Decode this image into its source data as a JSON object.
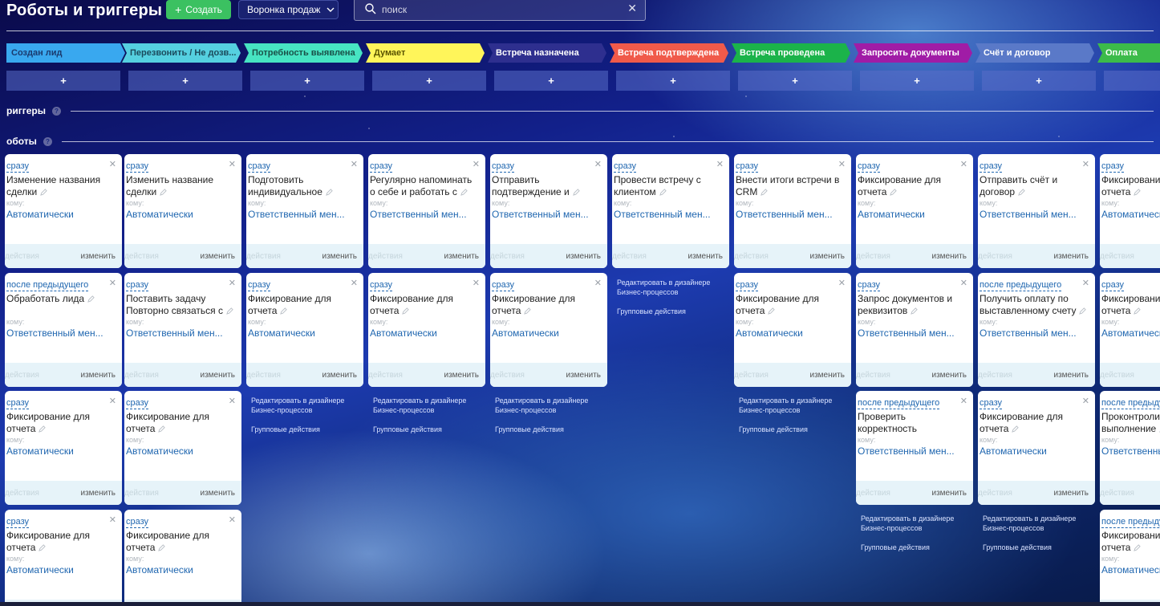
{
  "page": {
    "title": "Роботы и триггеры"
  },
  "header": {
    "create_label": "Создать",
    "pipeline_label": "Воронка продаж",
    "search_placeholder": "поиск"
  },
  "stages": [
    {
      "label": "Создан лид",
      "color": "#39a8ef",
      "text": "#1a3a6e"
    },
    {
      "label": "Перезвонить / Не дозв...",
      "color": "#55d0e0",
      "text": "#1b4a5c"
    },
    {
      "label": "Потребность выявлена",
      "color": "#47e4c2",
      "text": "#1a5048"
    },
    {
      "label": "Думает",
      "color": "#fff55a",
      "text": "#5a5400"
    },
    {
      "label": "Встреча назначена",
      "color": "#2e2f8f",
      "text": "#ffffff"
    },
    {
      "label": "Встреча подтверждена",
      "color": "#f05a4a",
      "text": "#ffffff"
    },
    {
      "label": "Встреча проведена",
      "color": "#1bb34a",
      "text": "#ffffff"
    },
    {
      "label": "Запросить документы",
      "color": "#a01ca6",
      "text": "#ffffff"
    },
    {
      "label": "Счёт и договор",
      "color": "#5a79c8",
      "text": "#ffffff"
    },
    {
      "label": "Оплата",
      "color": "#3cbb4a",
      "text": "#ffffff"
    }
  ],
  "add_label": "+",
  "sections": {
    "triggers": "риггеры",
    "robots": "оботы"
  },
  "common": {
    "to_label": "кому:",
    "actions_label": "действия",
    "edit_label": "изменить",
    "bp_designer": "Редактировать в дизайнере Бизнес-процессов",
    "group_actions": "Групповые действия"
  },
  "robots": {
    "c0r0": {
      "delay": "сразу",
      "name": "Изменение названия сделки",
      "resp": "Автоматически"
    },
    "c1r0": {
      "delay": "сразу",
      "name": "Изменить название сделки",
      "resp": "Автоматически"
    },
    "c2r0": {
      "delay": "сразу",
      "name": "Подготовить индивидуальное",
      "resp": "Ответственный мен..."
    },
    "c3r0": {
      "delay": "сразу",
      "name": "Регулярно напоминать о себе и работать с",
      "resp": "Ответственный мен..."
    },
    "c4r0": {
      "delay": "сразу",
      "name": "Отправить подтверждение и",
      "resp": "Ответственный мен..."
    },
    "c5r0": {
      "delay": "сразу",
      "name": "Провести встречу с клиентом",
      "resp": "Ответственный мен..."
    },
    "c6r0": {
      "delay": "сразу",
      "name": "Внести итоги встречи в CRM",
      "resp": "Ответственный мен..."
    },
    "c7r0": {
      "delay": "сразу",
      "name": "Фиксирование для отчета",
      "resp": "Автоматически"
    },
    "c8r0": {
      "delay": "сразу",
      "name": "Отправить счёт и договор",
      "resp": "Ответственный мен..."
    },
    "c9r0": {
      "delay": "сразу",
      "name": "Фиксирование для отчета",
      "resp": "Автоматически"
    },
    "c0r1": {
      "delay": "после предыдущего",
      "name": "Обработать лида",
      "resp": "Ответственный мен..."
    },
    "c1r1": {
      "delay": "сразу",
      "name": "Поставить задачу Повторно связаться с",
      "resp": "Ответственный мен..."
    },
    "c2r1": {
      "delay": "сразу",
      "name": "Фиксирование для отчета",
      "resp": "Автоматически"
    },
    "c3r1": {
      "delay": "сразу",
      "name": "Фиксирование для отчета",
      "resp": "Автоматически"
    },
    "c4r1": {
      "delay": "сразу",
      "name": "Фиксирование для отчета",
      "resp": "Автоматически"
    },
    "c6r1": {
      "delay": "сразу",
      "name": "Фиксирование для отчета",
      "resp": "Автоматически"
    },
    "c7r1": {
      "delay": "сразу",
      "name": "Запрос документов и реквизитов",
      "resp": "Ответственный мен..."
    },
    "c8r1": {
      "delay": "после предыдущего",
      "name": "Получить оплату по выставленному счету",
      "resp": "Ответственный мен..."
    },
    "c9r1": {
      "delay": "сразу",
      "name": "Фиксирование для отчета",
      "resp": "Автоматически"
    },
    "c0r2": {
      "delay": "сразу",
      "name": "Фиксирование для отчета",
      "resp": "Автоматически"
    },
    "c1r2": {
      "delay": "сразу",
      "name": "Фиксирование для отчета",
      "resp": "Автоматически"
    },
    "c7r2": {
      "delay": "после предыдущего",
      "name": "Проверить корректность полученных документов",
      "resp": "Ответственный мен..."
    },
    "c8r2": {
      "delay": "сразу",
      "name": "Фиксирование для отчета",
      "resp": "Автоматически"
    },
    "c9r2": {
      "delay": "после предыдущего",
      "name": "Проконтролировать выполнение",
      "resp": "Ответственный мен..."
    },
    "c0r3": {
      "delay": "сразу",
      "name": "Фиксирование для отчета",
      "resp": "Автоматически"
    },
    "c1r3": {
      "delay": "сразу",
      "name": "Фиксирование для отчета",
      "resp": "Автоматически"
    },
    "c9r3": {
      "delay": "после предыдущего",
      "name": "Фиксирование для отчета",
      "resp": "Автоматически"
    }
  }
}
